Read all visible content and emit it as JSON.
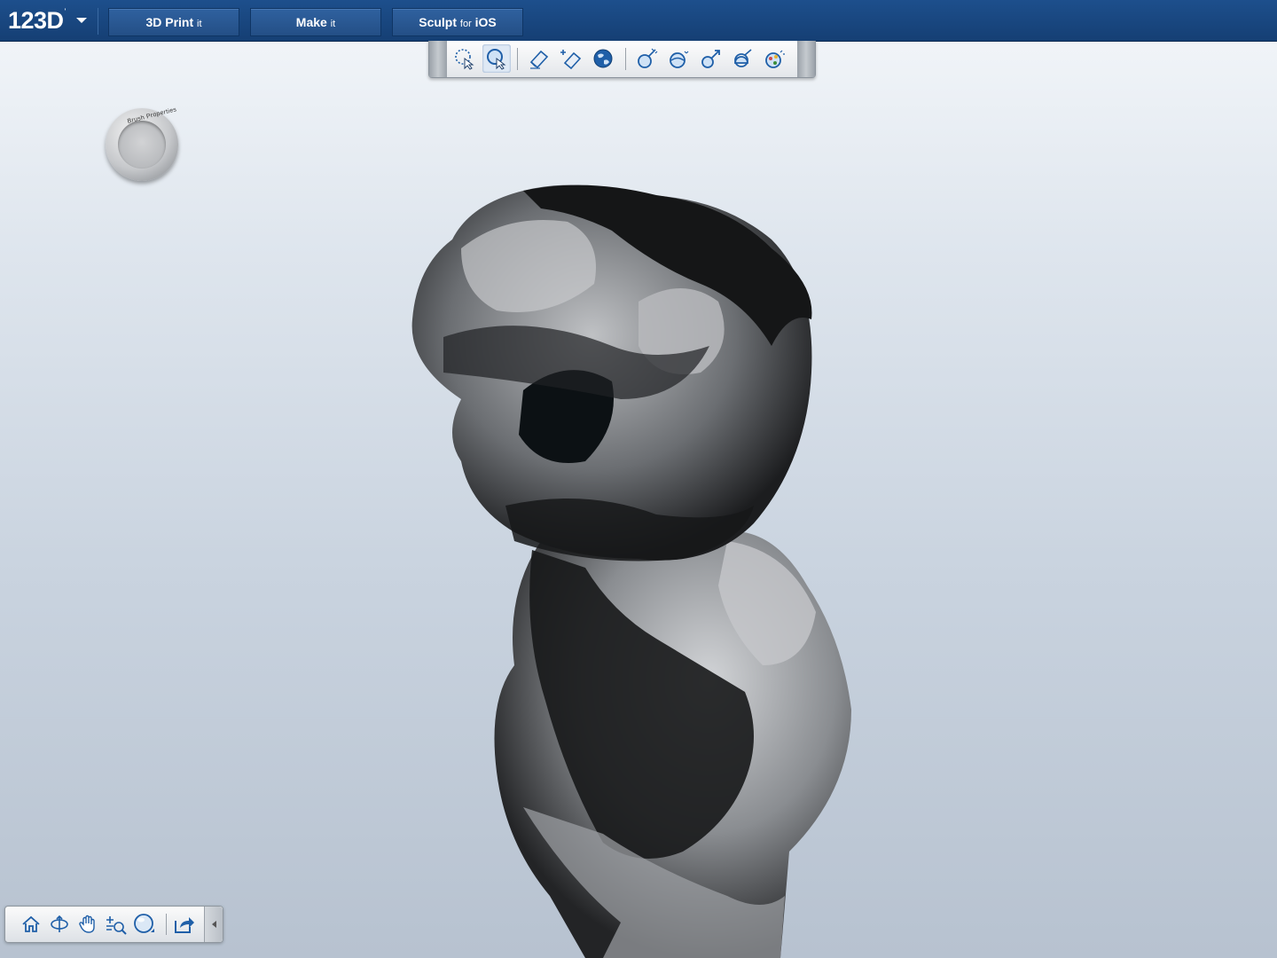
{
  "app": {
    "logo_text": "123D",
    "logo_sup": "'"
  },
  "nav": {
    "print": {
      "main": "3D Print",
      "sub": "it"
    },
    "make": {
      "main": "Make",
      "sub": "it"
    },
    "sculpt": {
      "main": "Sculpt",
      "mid": "for",
      "tail": "iOS"
    }
  },
  "toolbar": {
    "tools": [
      {
        "name": "select-region-icon",
        "active": false
      },
      {
        "name": "select-zoom-icon",
        "active": true
      },
      {
        "name": "eraser-icon",
        "active": false
      },
      {
        "name": "eraser-add-icon",
        "active": false
      },
      {
        "name": "globe-icon",
        "active": false
      },
      {
        "name": "inflate-brush-icon",
        "active": false
      },
      {
        "name": "smooth-brush-icon",
        "active": false
      },
      {
        "name": "pull-brush-icon",
        "active": false
      },
      {
        "name": "flatten-brush-icon",
        "active": false
      },
      {
        "name": "paint-brush-icon",
        "active": false
      }
    ]
  },
  "brush": {
    "label": "Brush Properties"
  },
  "navbar": {
    "tools": [
      "home-icon",
      "orbit-icon",
      "pan-icon",
      "zoom-icon",
      "view-sphere-icon",
      "share-icon"
    ]
  },
  "colors": {
    "topbar": "#1d4f8c",
    "button": "#2f619f",
    "icon": "#1f5fa8"
  }
}
